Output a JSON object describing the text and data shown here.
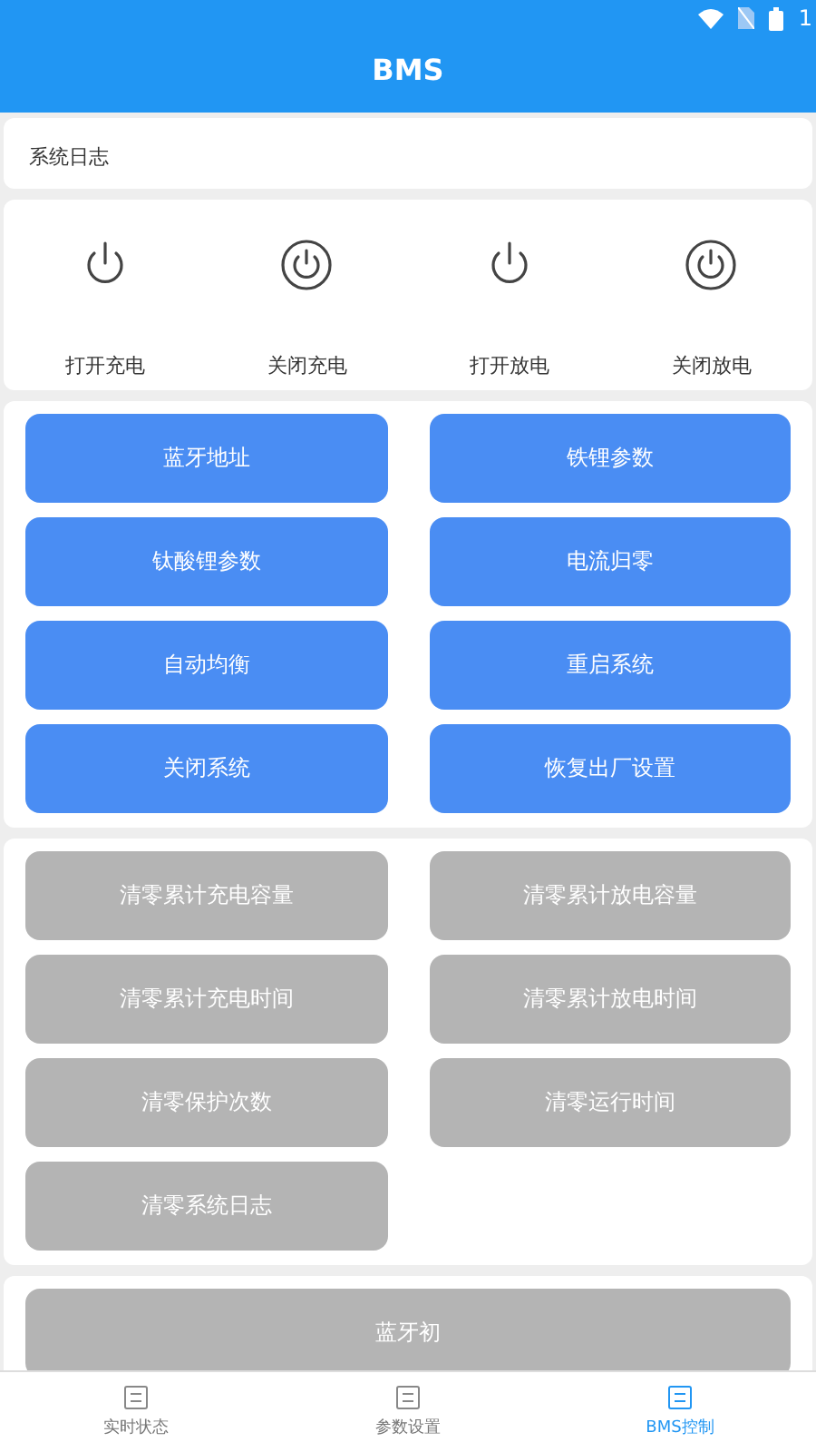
{
  "status_bar": {
    "time": "1"
  },
  "app_bar": {
    "title": "BMS"
  },
  "log_card": {
    "label": "系统日志"
  },
  "power_controls": [
    {
      "label": "打开充电",
      "kind": "plain"
    },
    {
      "label": "关闭充电",
      "kind": "ring"
    },
    {
      "label": "打开放电",
      "kind": "plain"
    },
    {
      "label": "关闭放电",
      "kind": "ring"
    }
  ],
  "button_groups": [
    {
      "buttons": [
        {
          "label": "蓝牙地址",
          "disabled": false
        },
        {
          "label": "铁锂参数",
          "disabled": false
        },
        {
          "label": "钛酸锂参数",
          "disabled": false
        },
        {
          "label": "电流归零",
          "disabled": false
        },
        {
          "label": "自动均衡",
          "disabled": false
        },
        {
          "label": "重启系统",
          "disabled": false
        },
        {
          "label": "关闭系统",
          "disabled": false
        },
        {
          "label": "恢复出厂设置",
          "disabled": false
        }
      ]
    },
    {
      "buttons": [
        {
          "label": "清零累计充电容量",
          "disabled": true
        },
        {
          "label": "清零累计放电容量",
          "disabled": true
        },
        {
          "label": "清零累计充电时间",
          "disabled": true
        },
        {
          "label": "清零累计放电时间",
          "disabled": true
        },
        {
          "label": "清零保护次数",
          "disabled": true
        },
        {
          "label": "清零运行时间",
          "disabled": true
        },
        {
          "label": "清零系统日志",
          "disabled": true
        }
      ]
    }
  ],
  "wide_button": {
    "label": "蓝牙初",
    "disabled": true
  },
  "bottom_nav": [
    {
      "label": "实时状态",
      "selected": false
    },
    {
      "label": "参数设置",
      "selected": false
    },
    {
      "label": "BMS控制",
      "selected": true
    }
  ]
}
